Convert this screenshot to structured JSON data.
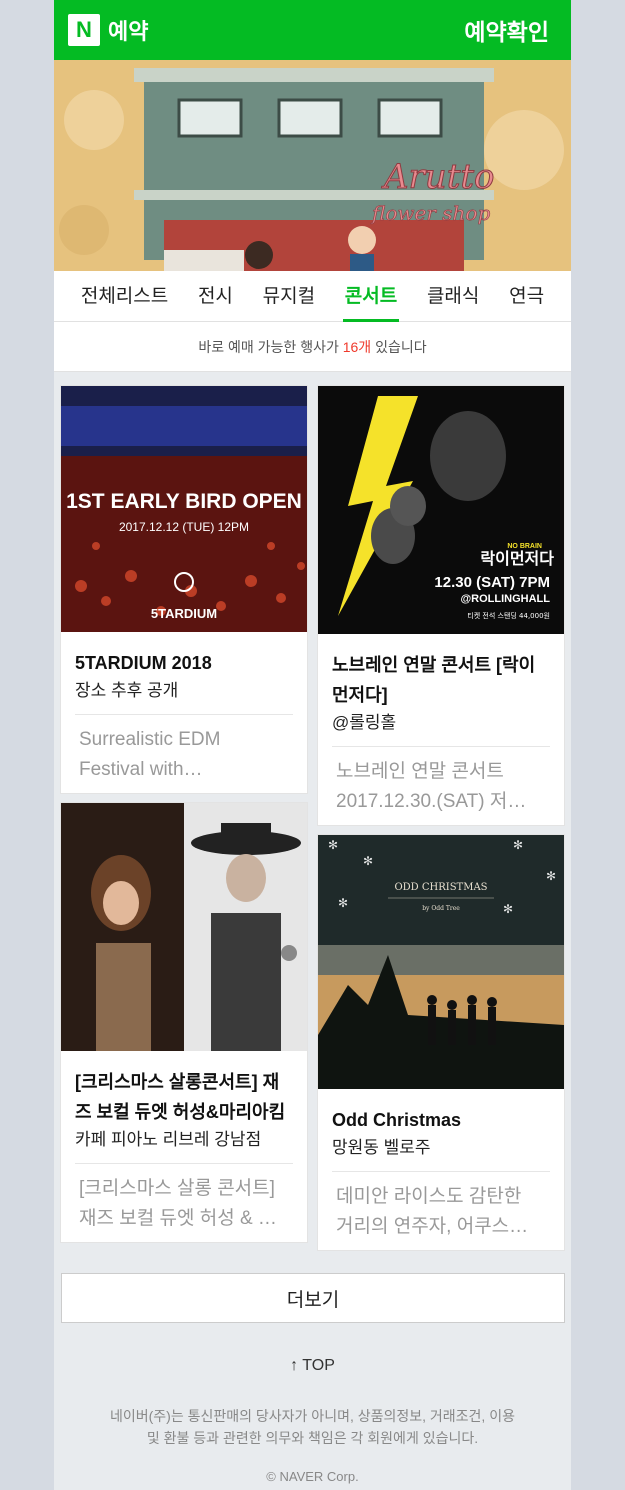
{
  "header": {
    "logo_letter": "N",
    "title": "예약",
    "confirm_label": "예약확인",
    "brand_color": "#04bb23"
  },
  "banner": {
    "shop_name": "Arutto",
    "shop_sub": "flower shop"
  },
  "tabs": [
    {
      "label": "전체리스트",
      "active": false
    },
    {
      "label": "전시",
      "active": false
    },
    {
      "label": "뮤지컬",
      "active": false
    },
    {
      "label": "콘서트",
      "active": true
    },
    {
      "label": "클래식",
      "active": false
    },
    {
      "label": "연극",
      "active": false
    }
  ],
  "count_bar": {
    "prefix": "바로 예매 가능한 행사가 ",
    "count": "16개",
    "suffix": " 있습니다"
  },
  "cards": [
    {
      "title": "5TARDIUM 2018",
      "place": "장소 추후 공개",
      "desc_line1": "Surrealistic EDM",
      "desc_line2": "Festival with…",
      "poster": {
        "headline": "1ST EARLY BIRD OPEN",
        "date": "2017.12.12 (TUE) 12PM",
        "brand": "5TARDIUM"
      }
    },
    {
      "title": "노브레인 연말 콘서트 [락이 먼저다]",
      "place": "@롤링홀",
      "desc_line1": "노브레인 연말 콘서트",
      "desc_line2": "2017.12.30.(SAT) 저…",
      "poster": {
        "band": "NO BRAIN",
        "logo": "락이먼저다",
        "date": "12.30 (SAT) 7PM",
        "venue": "@ROLLINGHALL",
        "ticket": "티켓 전석 스탠딩 44,000원"
      }
    },
    {
      "title": "[크리스마스 살롱콘서트] 재즈 보컬 듀엣 허성&마리아킴",
      "place": "카페 피아노 리브레 강남점",
      "desc_line1": "[크리스마스 살롱 콘서트]",
      "desc_line2": "재즈 보컬 듀엣 허성 & …"
    },
    {
      "title": "Odd Christmas",
      "place": "망원동 벨로주",
      "desc_line1": "데미안 라이스도 감탄한",
      "desc_line2": "거리의 연주자, 어쿠스…",
      "poster": {
        "headline": "ODD CHRISTMAS",
        "by": "by Odd Tree"
      }
    }
  ],
  "more_label": "더보기",
  "top_label": "↑ TOP",
  "footer": {
    "note_line1": "네이버(주)는 통신판매의 당사자가 아니며, 상품의정보, 거래조건, 이용",
    "note_line2": "및 환불 등과 관련한 의무와 책임은 각 회원에게 있습니다.",
    "copyright": "© NAVER Corp."
  }
}
